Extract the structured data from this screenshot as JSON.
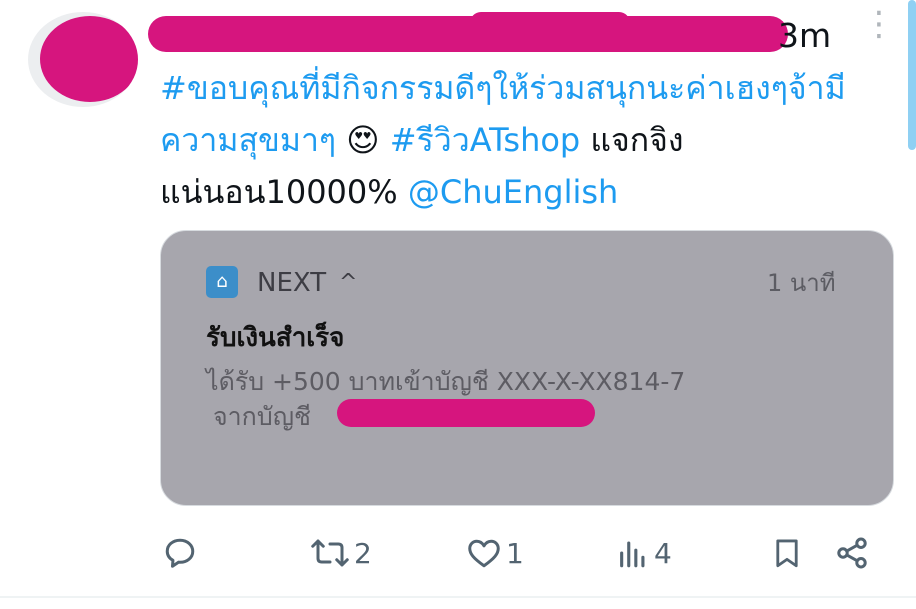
{
  "tweet": {
    "time": "3m",
    "text": {
      "part1": "#ขอบคุณที่มีกิจกรรมดีๆให้ร่วมสนุกนะค่าเฮงๆจ้ามีความสุขมาๆ",
      "emoji": "😍",
      "hashtag": "#รีวิวATshop",
      "part2": " แจกจิงแน่นอน10000%",
      "mention": "@ChuEnglish"
    }
  },
  "notification": {
    "app_name": "NEXT",
    "caret": "^",
    "time": "1 นาที",
    "title": "รับเงินสำเร็จ",
    "line1": "ได้รับ +500 บาทเข้าบัญชี  XXX-X-XX814-7",
    "line2": "จากบัญชี"
  },
  "actions": {
    "reply_count": "",
    "retweet_count": "2",
    "like_count": "1",
    "views_count": "4"
  },
  "colors": {
    "link": "#1d9bf0",
    "redaction": "#d6157e",
    "card_bg": "#a7a6ad"
  }
}
